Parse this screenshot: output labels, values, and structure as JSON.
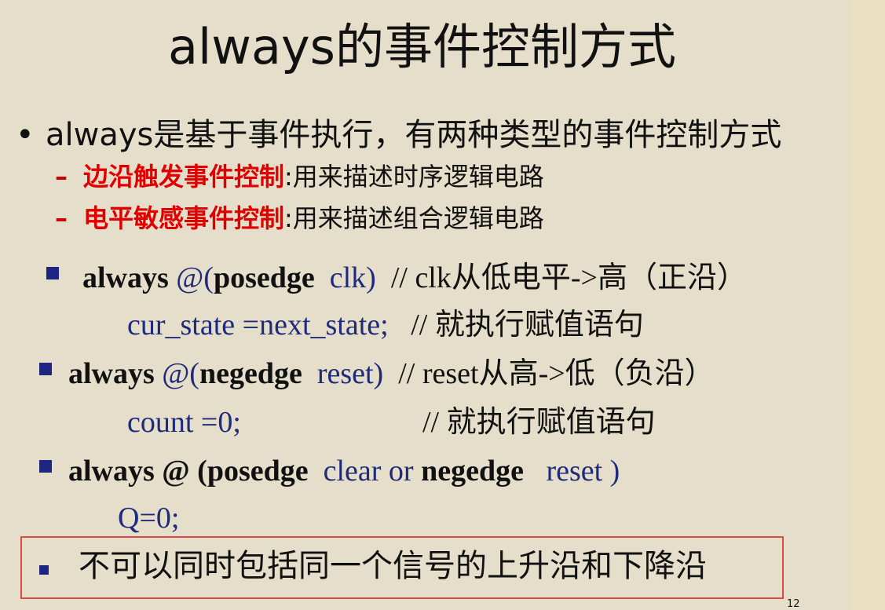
{
  "title": "always的事件控制方式",
  "main_bullet": {
    "symbol": "•",
    "text": "always是基于事件执行，有两种类型的事件控制方式"
  },
  "sub_bullets": [
    {
      "dash": "–",
      "highlight": "边沿触发事件控制",
      "rest": ":用来描述时序逻辑电路"
    },
    {
      "dash": "–",
      "highlight": "电平敏感事件控制",
      "rest": ":用来描述组合逻辑电路"
    }
  ],
  "code_blocks": [
    {
      "kw1": "always",
      "at": "@(",
      "kw2": "posedge",
      "sig": "clk)",
      "comment": "// clk从低电平->高（正沿）",
      "body": "cur_state =next_state;",
      "body_comment": "// 就执行赋值语句"
    },
    {
      "kw1": "always",
      "at": "@(",
      "kw2": "negedge",
      "sig": "reset)",
      "comment": "// reset从高->低（负沿）",
      "body": "count =0;",
      "body_comment": "// 就执行赋值语句"
    },
    {
      "kw1": "always",
      "at": "@",
      "paren": "(",
      "kw2": "posedge",
      "sig": "clear or",
      "kw3": "negedge",
      "sig2": "reset )",
      "body": "Q=0;"
    }
  ],
  "boxed_note": "不可以同时包括同一个信号的上升沿和下降沿",
  "page_number": "12",
  "colors": {
    "background": "#e5decb",
    "navy": "#1f2a7a",
    "red": "#e00000",
    "box_border": "#e04848"
  }
}
